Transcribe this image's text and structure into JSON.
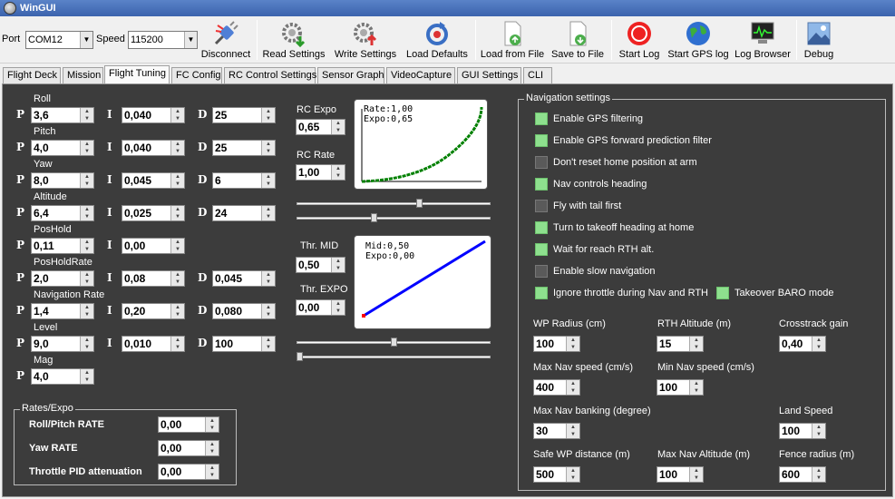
{
  "window": {
    "title": "WinGUI"
  },
  "toolbar": {
    "port_label": "Port",
    "port_value": "COM12",
    "speed_label": "Speed",
    "speed_value": "115200",
    "buttons": [
      "Disconnect",
      "Read Settings",
      "Write Settings",
      "Load Defaults",
      "Load from File",
      "Save to File",
      "Start Log",
      "Start GPS log",
      "Log Browser",
      "Debug"
    ]
  },
  "tabs": [
    "Flight Deck",
    "Mission",
    "Flight Tuning",
    "FC Config",
    "RC Control Settings",
    "Sensor Graph",
    "VideoCapture",
    "GUI Settings",
    "CLI"
  ],
  "pid": {
    "p": "P",
    "i": "I",
    "d": "D",
    "rows": [
      {
        "name": "Roll",
        "p": "3,6",
        "i": "0,040",
        "d": "25"
      },
      {
        "name": "Pitch",
        "p": "4,0",
        "i": "0,040",
        "d": "25"
      },
      {
        "name": "Yaw",
        "p": "8,0",
        "i": "0,045",
        "d": "6"
      },
      {
        "name": "Altitude",
        "p": "6,4",
        "i": "0,025",
        "d": "24"
      },
      {
        "name": "PosHold",
        "p": "0,11",
        "i": "0,00",
        "d": ""
      },
      {
        "name": "PosHoldRate",
        "p": "2,0",
        "i": "0,08",
        "d": "0,045"
      },
      {
        "name": "Navigation Rate",
        "p": "1,4",
        "i": "0,20",
        "d": "0,080"
      },
      {
        "name": "Level",
        "p": "9,0",
        "i": "0,010",
        "d": "100"
      },
      {
        "name": "Mag",
        "p": "4,0",
        "i": "",
        "d": ""
      }
    ]
  },
  "rc": {
    "expo_label": "RC Expo",
    "expo_value": "0,65",
    "rate_label": "RC Rate",
    "rate_value": "1,00",
    "graph_line1": "Rate:1,00",
    "graph_line2": "Expo:0,65",
    "thr_mid_label": "Thr. MID",
    "thr_mid_value": "0,50",
    "thr_expo_label": "Thr. EXPO",
    "thr_expo_value": "0,00",
    "thr_graph_line1": "Mid:0,50",
    "thr_graph_line2": "Expo:0,00",
    "curve_color": "#008000",
    "thr_color": "#0000ff"
  },
  "rates": {
    "title": "Rates/Expo",
    "roll_pitch_label": "Roll/Pitch RATE",
    "roll_pitch_value": "0,00",
    "yaw_label": "Yaw RATE",
    "yaw_value": "0,00",
    "tpa_label": "Throttle PID attenuation",
    "tpa_value": "0,00"
  },
  "nav": {
    "title": "Navigation settings",
    "checks": [
      {
        "label": "Enable GPS filtering",
        "checked": true
      },
      {
        "label": "Enable GPS forward prediction filter",
        "checked": true
      },
      {
        "label": "Don't reset home position at arm",
        "checked": false
      },
      {
        "label": "Nav controls heading",
        "checked": true
      },
      {
        "label": "Fly with tail first",
        "checked": false
      },
      {
        "label": "Turn to takeoff heading at home",
        "checked": true
      },
      {
        "label": "Wait for reach RTH alt.",
        "checked": true
      },
      {
        "label": "Enable slow navigation",
        "checked": false
      },
      {
        "label": "Ignore throttle during Nav and RTH",
        "checked": true
      }
    ],
    "baro_label": "Takeover BARO mode",
    "baro_checked": true,
    "wp_radius_label": "WP Radius (cm)",
    "wp_radius": "100",
    "rth_alt_label": "RTH Altitude (m)",
    "rth_alt": "15",
    "crosstrack_label": "Crosstrack gain",
    "crosstrack": "0,40",
    "max_speed_label": "Max Nav speed (cm/s)",
    "max_speed": "400",
    "min_speed_label": "Min Nav speed (cm/s)",
    "min_speed": "100",
    "max_bank_label": "Max Nav banking (degree)",
    "max_bank": "30",
    "land_speed_label": "Land Speed",
    "land_speed": "100",
    "safe_wp_label": "Safe WP distance (m)",
    "safe_wp": "500",
    "max_alt_label": "Max Nav Altitude (m)",
    "max_alt": "100",
    "fence_label": "Fence radius (m)",
    "fence": "600"
  }
}
